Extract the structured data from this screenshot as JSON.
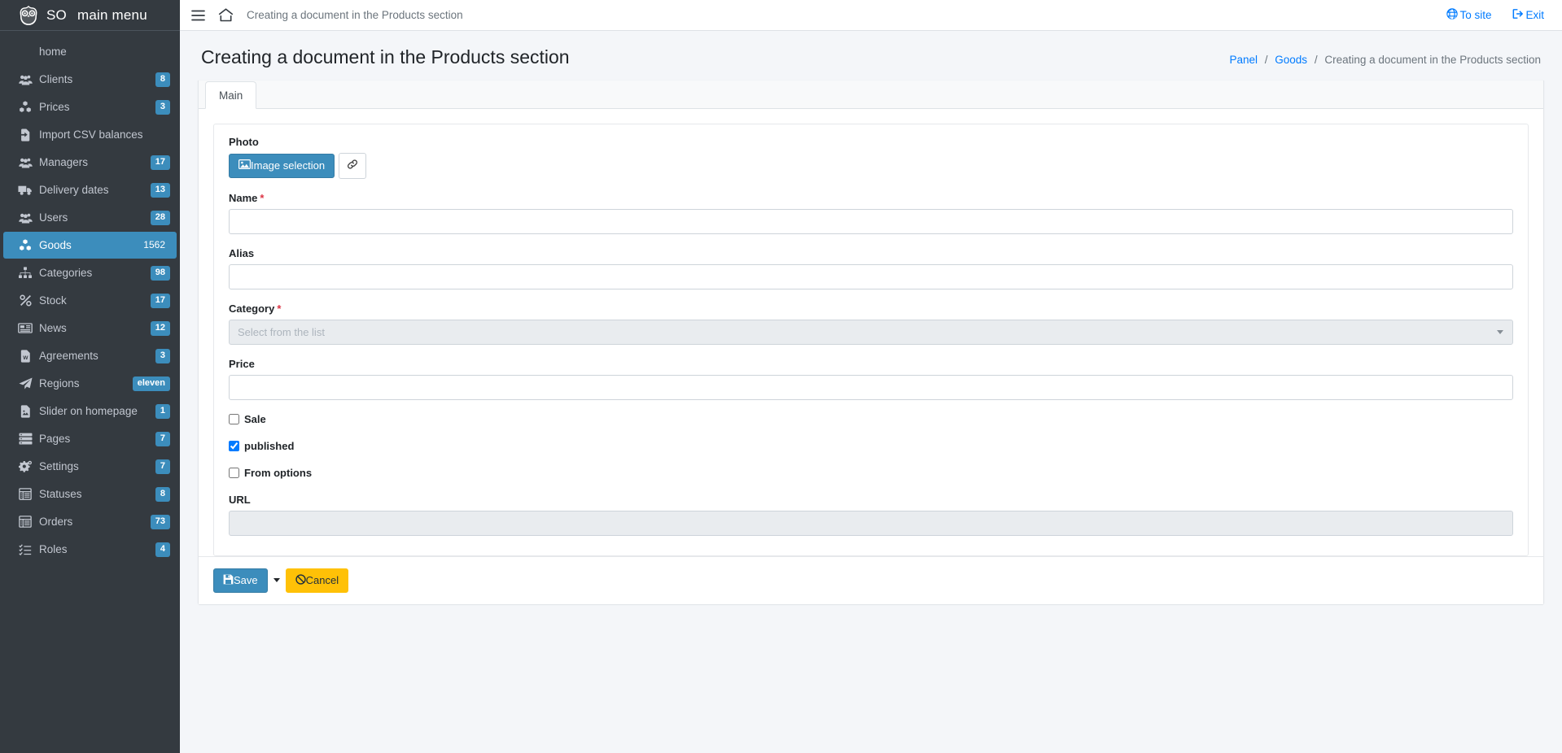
{
  "brand": {
    "logo_icon": "owl-icon",
    "short": "SO",
    "title": "main menu"
  },
  "sidebar": {
    "items": [
      {
        "label": "home",
        "icon": "none",
        "badge": ""
      },
      {
        "label": "Clients",
        "icon": "users-icon",
        "badge": "8"
      },
      {
        "label": "Prices",
        "icon": "cubes-icon",
        "badge": "3"
      },
      {
        "label": "Import CSV balances",
        "icon": "file-import-icon",
        "badge": ""
      },
      {
        "label": "Managers",
        "icon": "users-icon",
        "badge": "17"
      },
      {
        "label": "Delivery dates",
        "icon": "truck-icon",
        "badge": "13"
      },
      {
        "label": "Users",
        "icon": "users-icon",
        "badge": "28"
      },
      {
        "label": "Goods",
        "icon": "cubes-icon",
        "badge": "1562",
        "active": true
      },
      {
        "label": "Categories",
        "icon": "sitemap-icon",
        "badge": "98"
      },
      {
        "label": "Stock",
        "icon": "percent-icon",
        "badge": "17"
      },
      {
        "label": "News",
        "icon": "newspaper-icon",
        "badge": "12"
      },
      {
        "label": "Agreements",
        "icon": "file-word-icon",
        "badge": "3"
      },
      {
        "label": "Regions",
        "icon": "paper-plane-icon",
        "badge": "eleven"
      },
      {
        "label": "Slider on homepage",
        "icon": "file-image-icon",
        "badge": "1"
      },
      {
        "label": "Pages",
        "icon": "server-icon",
        "badge": "7"
      },
      {
        "label": "Settings",
        "icon": "cogs-icon",
        "badge": "7"
      },
      {
        "label": "Statuses",
        "icon": "table-icon",
        "badge": "8"
      },
      {
        "label": "Orders",
        "icon": "table-icon",
        "badge": "73"
      },
      {
        "label": "Roles",
        "icon": "tasks-icon",
        "badge": "4"
      }
    ]
  },
  "topbar": {
    "menu_icon": "hamburger-icon",
    "home_icon": "home-icon",
    "title": "Creating a document in the Products section",
    "to_site": "To site",
    "to_site_icon": "globe-icon",
    "exit": "Exit",
    "exit_icon": "sign-out-icon"
  },
  "page": {
    "title": "Creating a document in the Products section",
    "breadcrumb": {
      "panel": "Panel",
      "goods": "Goods",
      "current": "Creating a document in the Products section",
      "separator": "/"
    }
  },
  "tabs": [
    {
      "label": "Main",
      "active": true
    }
  ],
  "form": {
    "photo": {
      "label": "Photo",
      "select_button": "Image selection",
      "select_button_icon": "image-icon",
      "link_button_icon": "link-icon"
    },
    "name": {
      "label": "Name",
      "required": "*",
      "value": "",
      "placeholder": ""
    },
    "alias": {
      "label": "Alias",
      "required": "",
      "value": "",
      "placeholder": ""
    },
    "category": {
      "label": "Category",
      "required": "*",
      "value": "",
      "placeholder": "Select from the list",
      "caret_icon": "chevron-down-icon"
    },
    "price": {
      "label": "Price",
      "required": "",
      "value": "",
      "placeholder": ""
    },
    "checkboxes": [
      {
        "label": "Sale",
        "checked": false
      },
      {
        "label": "published",
        "checked": true
      },
      {
        "label": "From options",
        "checked": false
      }
    ],
    "url": {
      "label": "URL",
      "value": "",
      "placeholder": "",
      "readonly": true
    }
  },
  "footer": {
    "save": "Save",
    "save_icon": "floppy-icon",
    "save_caret_icon": "caret-down-icon",
    "cancel": "Cancel",
    "cancel_icon": "ban-icon"
  },
  "colors": {
    "sidebar_bg": "#343a40",
    "accent": "#3c8dbc",
    "link": "#007bff",
    "warning": "#ffc107",
    "required": "#dc3545",
    "page_bg": "#f4f6f9"
  }
}
